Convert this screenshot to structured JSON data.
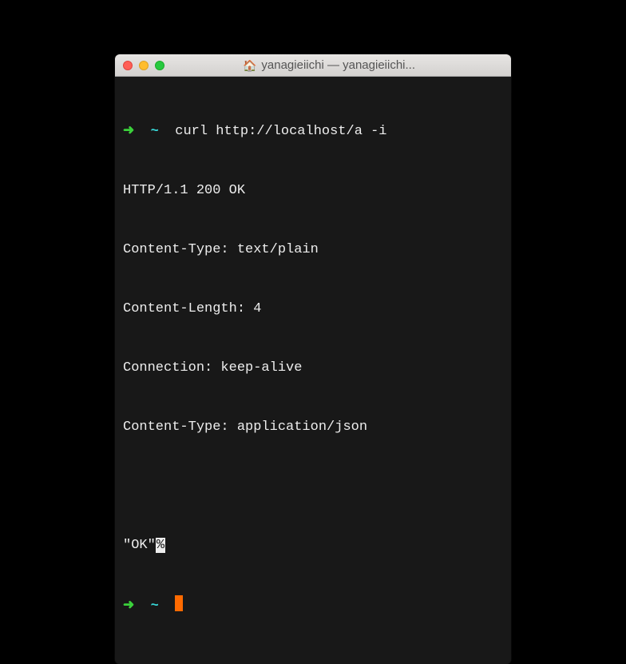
{
  "titlebar": {
    "home_icon": "🏠",
    "title": "yanagieiichi — yanagieiichi..."
  },
  "prompt": {
    "arrow": "➜",
    "path": "~"
  },
  "terminal": {
    "command": "curl http://localhost/a -i",
    "response": {
      "status": "HTTP/1.1 200 OK",
      "headers": [
        "Content-Type: text/plain",
        "Content-Length: 4",
        "Connection: keep-alive",
        "Content-Type: application/json"
      ],
      "body_quoted": "\"OK\"",
      "trailing": "%"
    }
  }
}
